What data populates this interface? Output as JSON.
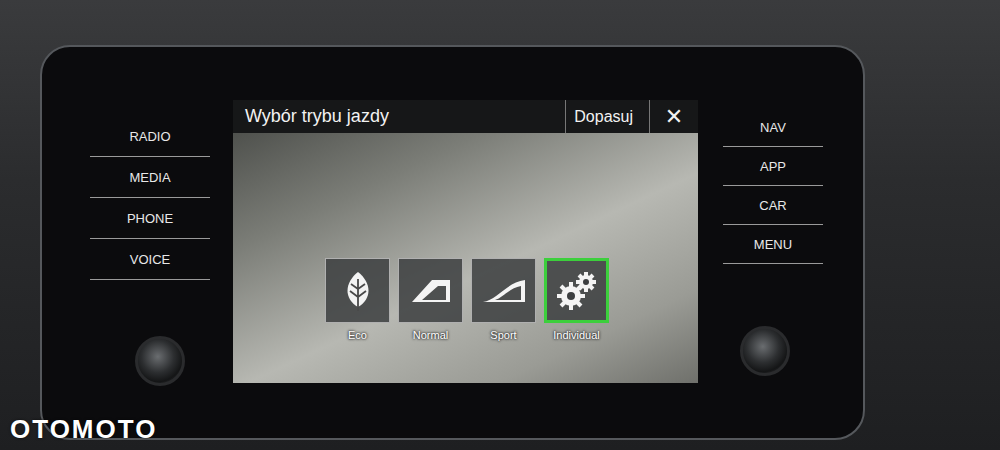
{
  "screen": {
    "title": "Wybór trybu jazdy",
    "action": "Dopasuj",
    "close": "✕"
  },
  "left_menu": [
    {
      "label": "RADIO"
    },
    {
      "label": "MEDIA"
    },
    {
      "label": "PHONE"
    },
    {
      "label": "VOICE"
    }
  ],
  "right_menu": [
    {
      "label": "NAV"
    },
    {
      "label": "APP"
    },
    {
      "label": "CAR"
    },
    {
      "label": "MENU"
    }
  ],
  "modes": [
    {
      "label": "Eco",
      "kind": "eco",
      "selected": false
    },
    {
      "label": "Normal",
      "kind": "normal",
      "selected": false
    },
    {
      "label": "Sport",
      "kind": "sport",
      "selected": false
    },
    {
      "label": "Individual",
      "kind": "individual",
      "selected": true
    }
  ],
  "watermark": "OTOMOTO"
}
